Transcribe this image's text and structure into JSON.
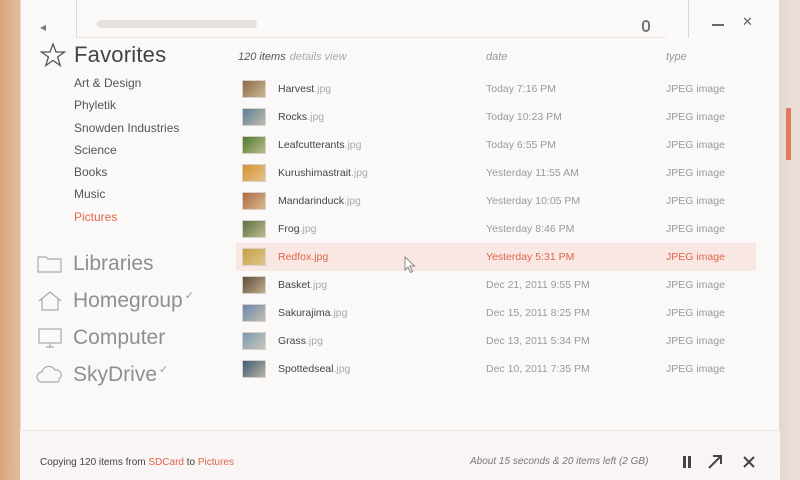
{
  "toolbar": {
    "back_icon": "back-arrow-icon",
    "mic_icon": "microphone-icon"
  },
  "sidebar": {
    "favorites_title": "Favorites",
    "favorites": [
      "Art & Design",
      "Phyletik",
      "Snowden Industries",
      "Science",
      "Books",
      "Music",
      "Pictures"
    ],
    "active_favorite": "Pictures",
    "locations": [
      {
        "label": "Libraries",
        "icon": "folder-icon",
        "tick": ""
      },
      {
        "label": "Homegroup",
        "icon": "home-icon",
        "tick": "✓"
      },
      {
        "label": "Computer",
        "icon": "monitor-icon",
        "tick": ""
      },
      {
        "label": "SkyDrive",
        "icon": "cloud-icon",
        "tick": "✓"
      }
    ]
  },
  "list": {
    "count": "120 items",
    "view_label": "details view",
    "col_date": "date",
    "col_type": "type",
    "rows": [
      {
        "name": "Harvest",
        "ext": ".jpg",
        "date": "Today 7:16 PM",
        "type": "JPEG image",
        "thumb": "#8a6a4a"
      },
      {
        "name": "Rocks",
        "ext": ".jpg",
        "date": "Today 10:23 PM",
        "type": "JPEG image",
        "thumb": "#5a7f9a"
      },
      {
        "name": "Leafcutterants",
        "ext": ".jpg",
        "date": "Today 6:55 PM",
        "type": "JPEG image",
        "thumb": "#4d7a2e"
      },
      {
        "name": "Kurushimastrait",
        "ext": ".jpg",
        "date": "Yesterday 11:55 AM",
        "type": "JPEG image",
        "thumb": "#d89030"
      },
      {
        "name": "Mandarinduck",
        "ext": ".jpg",
        "date": "Yesterday 10:05 PM",
        "type": "JPEG image",
        "thumb": "#b06a40"
      },
      {
        "name": "Frog",
        "ext": ".jpg",
        "date": "Yesterday 8:46 PM",
        "type": "JPEG image",
        "thumb": "#5b7040"
      },
      {
        "name": "Redfox",
        "ext": ".jpg",
        "date": "Yesterday 5:31 PM",
        "type": "JPEG image",
        "thumb": "#c4a040",
        "selected": true
      },
      {
        "name": "Basket",
        "ext": ".jpg",
        "date": "Dec 21, 2011 9:55 PM",
        "type": "JPEG image",
        "thumb": "#5e4a3a"
      },
      {
        "name": "Sakurajima",
        "ext": ".jpg",
        "date": "Dec 15, 2011 8:25 PM",
        "type": "JPEG image",
        "thumb": "#6a86b0"
      },
      {
        "name": "Grass",
        "ext": ".jpg",
        "date": "Dec 13, 2011 5:34 PM",
        "type": "JPEG image",
        "thumb": "#7a9ab8"
      },
      {
        "name": "Spottedseal",
        "ext": ".jpg",
        "date": "Dec 10, 2011 7:35 PM",
        "type": "JPEG image",
        "thumb": "#3e5a7a"
      }
    ]
  },
  "status": {
    "copy_prefix": "Copying 120 items from",
    "source": "SDCard",
    "to": "to",
    "dest": "Pictures",
    "eta": "About 15 seconds & 20 items left (2 GB)",
    "pause_icon": "pause-icon",
    "expand_icon": "expand-arrow-icon",
    "close_icon": "close-icon"
  },
  "colors": {
    "accent": "#e0654a",
    "selected_row": "#f8e7e2"
  }
}
